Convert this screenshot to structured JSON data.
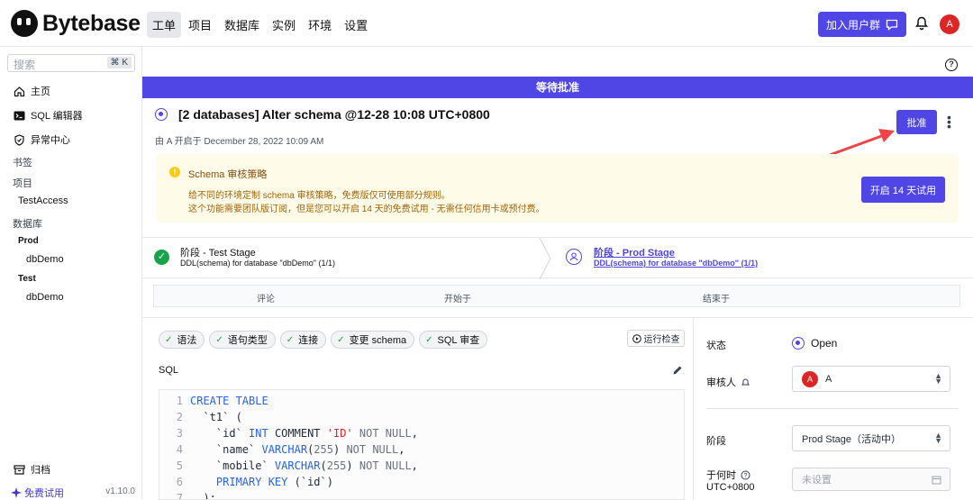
{
  "app": {
    "brand": "Bytebase",
    "accent": "#4f46e5"
  },
  "nav": {
    "items": [
      "工单",
      "项目",
      "数据库",
      "实例",
      "环境",
      "设置"
    ],
    "active": "工单"
  },
  "header": {
    "join_label": "加入用户群",
    "avatar_initial": "A"
  },
  "sidebar": {
    "search_placeholder": "搜索",
    "search_shortcut": "⌘ K",
    "main_items": [
      "主页",
      "SQL 编辑器",
      "异常中心"
    ],
    "bookmarks_heading": "书签",
    "projects_heading": "项目",
    "project_item": "TestAccess",
    "databases_heading": "数据库",
    "env_prod": "Prod",
    "db_prod": "dbDemo",
    "env_test": "Test",
    "db_test": "dbDemo",
    "archive": "归档",
    "free_trial": "免费试用",
    "version": "v1.10.0"
  },
  "issue": {
    "banner": "等待批准",
    "title": "[2 databases] Alter schema @12-28 10:08 UTC+0800",
    "subtitle": "由 A 开启于 December 28, 2022 10:09 AM",
    "approve_label": "批准"
  },
  "notice": {
    "title": "Schema 审核策略",
    "line1": "给不同的环境定制 schema 审核策略，免费版仅可使用部分规则。",
    "line2": "这个功能需要团队版订阅，但是您可以开启 14 天的免费试用 - 无需任何信用卡或预付费。",
    "trial_button": "开启 14 天试用"
  },
  "stages": [
    {
      "title": "阶段 - Test Stage",
      "sub": "DDL(schema) for database \"dbDemo\" (1/1)",
      "status": "done"
    },
    {
      "title": "阶段 - Prod Stage",
      "sub": "DDL(schema) for database \"dbDemo\" (1/1)",
      "status": "active"
    }
  ],
  "task_table": {
    "headers": [
      "评论",
      "开始于",
      "结束于"
    ]
  },
  "checks": {
    "chips": [
      "语法",
      "语句类型",
      "连接",
      "变更 schema",
      "SQL 审查"
    ],
    "run_label": "运行检查"
  },
  "sql": {
    "label": "SQL",
    "lines": [
      "CREATE TABLE",
      "  `t1` (",
      "    `id` INT COMMENT 'ID' NOT NULL,",
      "    `name` VARCHAR(255) NOT NULL,",
      "    `mobile` VARCHAR(255) NOT NULL,",
      "    PRIMARY KEY (`id`)",
      "  );"
    ]
  },
  "details": {
    "status_label": "状态",
    "status_value": "Open",
    "reviewer_label": "审核人",
    "reviewer_value": "A",
    "stage_label": "阶段",
    "stage_value": "Prod Stage（活动中）",
    "when_label": "于何时",
    "when_tz": "UTC+0800",
    "when_placeholder": "未设置"
  }
}
